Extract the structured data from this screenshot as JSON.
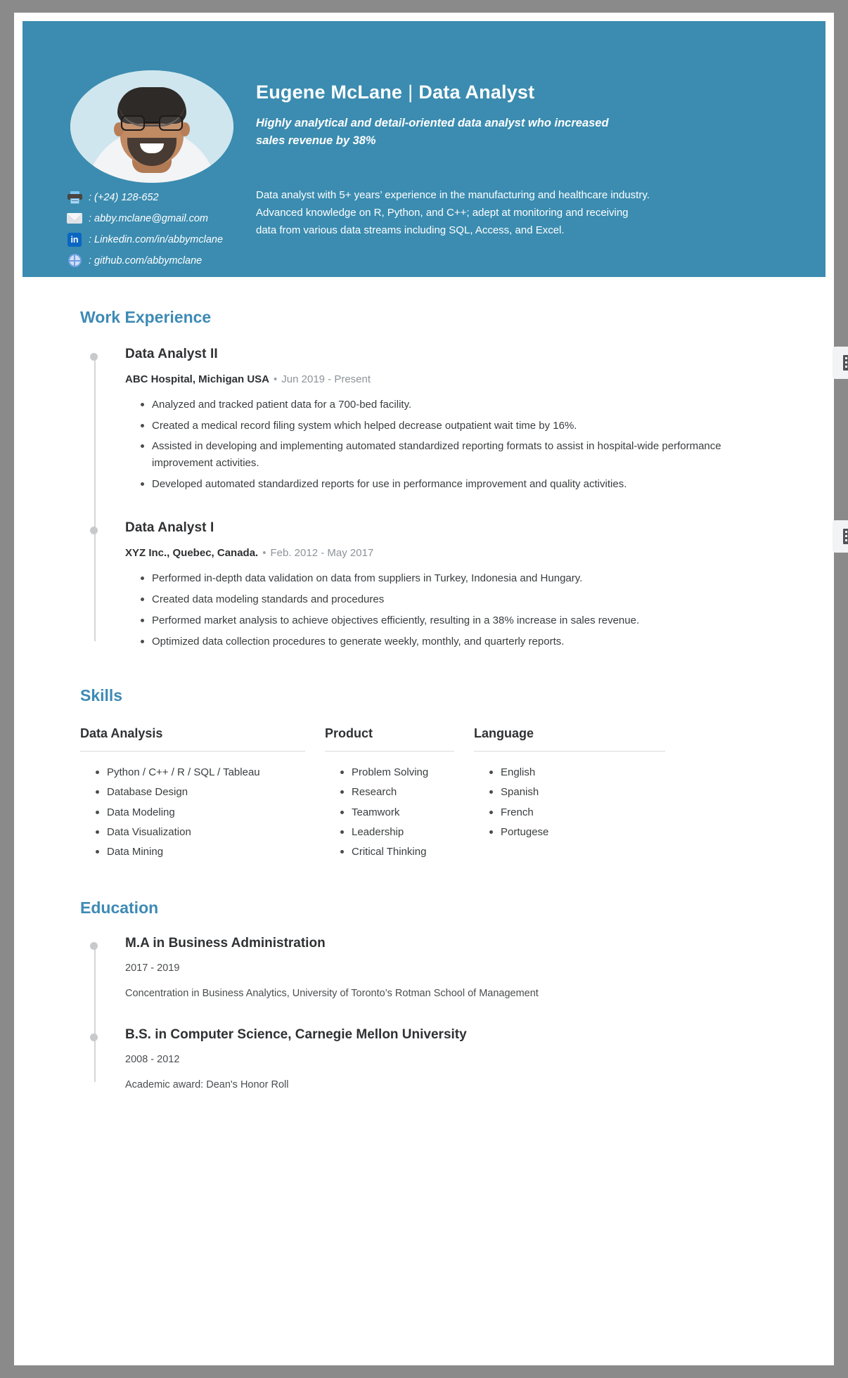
{
  "theme": {
    "header_bg": "#3b8cb0",
    "accent": "#3e8ab5",
    "page_bg": "#ffffff",
    "canvas_bg": "#8a8a8a"
  },
  "header": {
    "name": "Eugene McLane",
    "divider": "|",
    "role": "Data Analyst",
    "tagline": "Highly analytical and detail-oriented data analyst who increased sales revenue by 38%",
    "summary": "Data analyst with 5+ years’ experience in the manufacturing and healthcare industry. Advanced knowledge on R, Python, and C++; adept at monitoring and receiving data from various data streams including SQL, Access, and Excel.",
    "photo_alt": "profile-photo",
    "contacts": [
      {
        "icon": "printer-icon",
        "text": ": (+24) 128-652"
      },
      {
        "icon": "email-icon",
        "text": ": abby.mclane@gmail.com"
      },
      {
        "icon": "linkedin-icon",
        "icon_label": "in",
        "text": ": Linkedin.com/in/abbymclane"
      },
      {
        "icon": "globe-icon",
        "text": ": github.com/abbymclane"
      }
    ]
  },
  "work": {
    "section_title": "Work Experience",
    "jobs": [
      {
        "title": "Data Analyst II",
        "company": "ABC Hospital, Michigan USA",
        "separator": "•",
        "dates": "Jun 2019 - Present",
        "badge_icon": "building-icon",
        "bullets": [
          "Analyzed and tracked patient data for a 700-bed facility.",
          "Created a medical record filing system which helped decrease outpatient wait time by 16%.",
          "Assisted in developing and implementing automated standardized reporting formats to assist in hospital-wide performance improvement activities.",
          "Developed automated standardized reports for use in performance improvement and quality activities."
        ]
      },
      {
        "title": "Data Analyst I",
        "company": "XYZ Inc., Quebec, Canada.",
        "separator": "•",
        "dates": "Feb. 2012 - May 2017",
        "badge_icon": "building-icon",
        "bullets": [
          "Performed in-depth data validation on data from suppliers in Turkey, Indonesia and Hungary.",
          "Created data modeling standards and procedures",
          "Performed market analysis to achieve objectives efficiently, resulting in a 38% increase in sales revenue.",
          "Optimized data collection procedures to generate weekly, monthly, and quarterly reports."
        ]
      }
    ]
  },
  "skills": {
    "section_title": "Skills",
    "columns": [
      {
        "heading": "Data Analysis",
        "items": [
          "Python / C++ / R / SQL / Tableau",
          "Database Design",
          "Data Modeling",
          "Data Visualization",
          "Data Mining"
        ]
      },
      {
        "heading": "Product",
        "items": [
          "Problem Solving",
          "Research",
          "Teamwork",
          "Leadership",
          "Critical Thinking"
        ]
      },
      {
        "heading": "Language",
        "items": [
          "English",
          "Spanish",
          "French",
          "Portugese"
        ]
      }
    ]
  },
  "education": {
    "section_title": "Education",
    "items": [
      {
        "title": "M.A in Business Administration",
        "years": "2017 - 2019",
        "description": "Concentration in Business Analytics, University of Toronto’s Rotman School of Management"
      },
      {
        "title": "B.S. in Computer Science, Carnegie Mellon University",
        "years": "2008 - 2012",
        "description": "Academic award: Dean's Honor Roll"
      }
    ]
  }
}
